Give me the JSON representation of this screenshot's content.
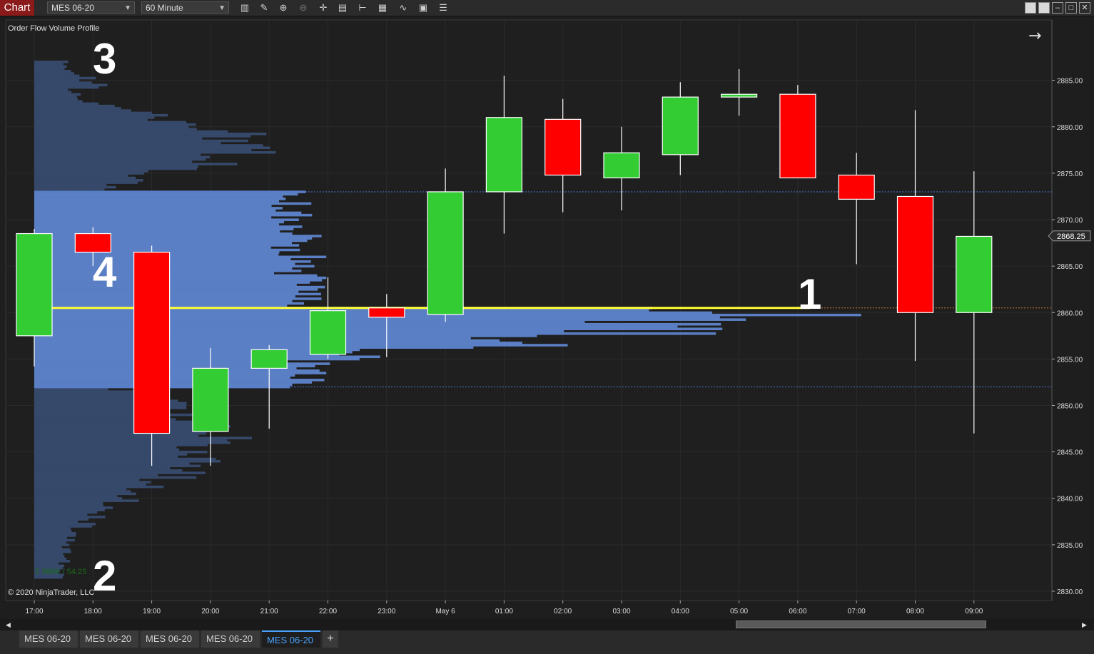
{
  "toolbar": {
    "app_label": "Chart",
    "instrument": "MES 06-20",
    "interval": "60 Minute",
    "icons": [
      "bar-type-icon",
      "draw-pencil-icon",
      "zoom-in-icon",
      "zoom-out-icon",
      "crosshair-icon",
      "data-box-icon",
      "properties-icon",
      "strategies-icon",
      "indicators-icon",
      "templates-icon",
      "list-icon"
    ]
  },
  "chart": {
    "indicator_label": "Order Flow Volume Profile",
    "copyright": "© 2020 NinjaTrader, LLC",
    "volume_summary": "Σ 888K / 54.25",
    "current_price": "2868.25",
    "annotations": [
      "1",
      "2",
      "3",
      "4"
    ],
    "colors": {
      "background": "#1f1f1f",
      "up": "#33cc33",
      "down": "#ff0000",
      "value_area": "#5b7fc4",
      "profile_outside": "#36496a",
      "poc": "#ffff33"
    }
  },
  "chart_data": {
    "type": "candlestick",
    "price_axis": [
      "2885.00",
      "2880.00",
      "2875.00",
      "2870.00",
      "2865.00",
      "2860.00",
      "2855.00",
      "2850.00",
      "2845.00",
      "2840.00",
      "2835.00",
      "2830.00"
    ],
    "ylim": [
      2829,
      2891.5
    ],
    "time_axis": [
      "17:00",
      "18:00",
      "19:00",
      "20:00",
      "21:00",
      "22:00",
      "23:00",
      "May 6",
      "01:00",
      "02:00",
      "03:00",
      "04:00",
      "05:00",
      "06:00",
      "07:00",
      "08:00",
      "09:00"
    ],
    "candles": [
      {
        "t": "17:00",
        "o": 2857.5,
        "h": 2869.0,
        "l": 2854.2,
        "c": 2868.5
      },
      {
        "t": "18:00",
        "o": 2868.5,
        "h": 2869.2,
        "l": 2865.0,
        "c": 2866.5
      },
      {
        "t": "19:00",
        "o": 2866.5,
        "h": 2867.2,
        "l": 2843.5,
        "c": 2847.0
      },
      {
        "t": "20:00",
        "o": 2847.2,
        "h": 2856.2,
        "l": 2843.5,
        "c": 2854.0
      },
      {
        "t": "21:00",
        "o": 2854.0,
        "h": 2856.5,
        "l": 2847.5,
        "c": 2856.0
      },
      {
        "t": "22:00",
        "o": 2855.5,
        "h": 2863.8,
        "l": 2855.0,
        "c": 2860.2
      },
      {
        "t": "23:00",
        "o": 2860.5,
        "h": 2862.0,
        "l": 2855.2,
        "c": 2859.5
      },
      {
        "t": "May 6",
        "o": 2859.8,
        "h": 2875.5,
        "l": 2859.0,
        "c": 2873.0
      },
      {
        "t": "01:00",
        "o": 2873.0,
        "h": 2885.5,
        "l": 2868.5,
        "c": 2881.0
      },
      {
        "t": "02:00",
        "o": 2880.8,
        "h": 2883.0,
        "l": 2870.8,
        "c": 2874.8
      },
      {
        "t": "03:00",
        "o": 2874.5,
        "h": 2880.0,
        "l": 2871.0,
        "c": 2877.2
      },
      {
        "t": "04:00",
        "o": 2877.0,
        "h": 2884.8,
        "l": 2874.8,
        "c": 2883.2
      },
      {
        "t": "05:00",
        "o": 2883.2,
        "h": 2886.2,
        "l": 2881.2,
        "c": 2883.5
      },
      {
        "t": "06:00",
        "o": 2883.5,
        "h": 2884.5,
        "l": 2874.5,
        "c": 2874.5
      },
      {
        "t": "07:00",
        "o": 2874.8,
        "h": 2877.2,
        "l": 2865.2,
        "c": 2872.2
      },
      {
        "t": "08:00",
        "o": 2872.5,
        "h": 2881.8,
        "l": 2854.8,
        "c": 2860.0
      },
      {
        "t": "09:00",
        "o": 2860.0,
        "h": 2875.2,
        "l": 2847.0,
        "c": 2868.2
      }
    ],
    "poc": 2860.5,
    "value_area_high": 2873.0,
    "value_area_low": 2852.0,
    "profile_range": [
      2831.5,
      2887.0
    ],
    "current_price": 2868.25
  },
  "tabs": [
    {
      "label": "MES 06-20",
      "active": false
    },
    {
      "label": "MES 06-20",
      "active": false
    },
    {
      "label": "MES 06-20",
      "active": false
    },
    {
      "label": "MES 06-20",
      "active": false
    },
    {
      "label": "MES 06-20",
      "active": true
    }
  ],
  "tab_add_label": "+"
}
